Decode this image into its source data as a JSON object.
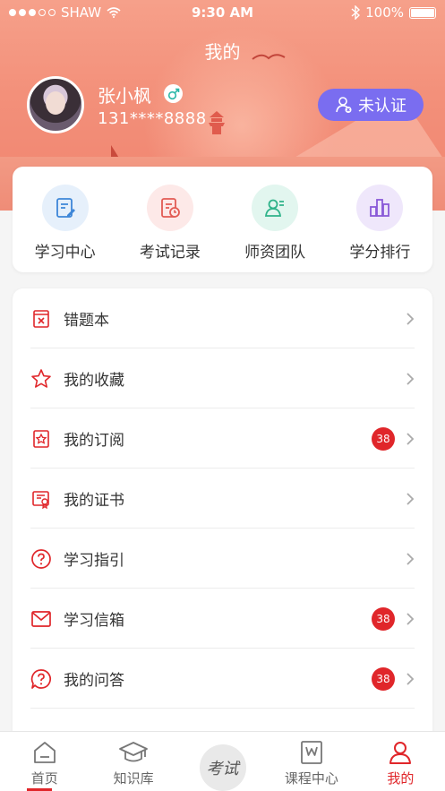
{
  "status": {
    "carrier": "SHAW",
    "time": "9:30 AM",
    "battery": "100%"
  },
  "header": {
    "title": "我的"
  },
  "profile": {
    "name": "张小枫",
    "phone": "131****8888",
    "verify_label": "未认证"
  },
  "quick_nav": [
    {
      "label": "学习中心",
      "icon": "study-center-icon",
      "bg": "#e6f0fb",
      "color": "#3d86d8"
    },
    {
      "label": "考试记录",
      "icon": "exam-record-icon",
      "bg": "#fde9e8",
      "color": "#e25b53"
    },
    {
      "label": "师资团队",
      "icon": "teacher-team-icon",
      "bg": "#e2f6ef",
      "color": "#2fb38a"
    },
    {
      "label": "学分排行",
      "icon": "credit-rank-icon",
      "bg": "#efe7fb",
      "color": "#8a5ad8"
    }
  ],
  "menu": [
    {
      "label": "错题本",
      "icon": "wrong-book-icon",
      "badge": ""
    },
    {
      "label": "我的收藏",
      "icon": "star-icon",
      "badge": ""
    },
    {
      "label": "我的订阅",
      "icon": "subscription-icon",
      "badge": "38"
    },
    {
      "label": "我的证书",
      "icon": "certificate-icon",
      "badge": ""
    },
    {
      "label": "学习指引",
      "icon": "question-circle-icon",
      "badge": ""
    },
    {
      "label": "学习信箱",
      "icon": "mail-icon",
      "badge": "38"
    },
    {
      "label": "我的问答",
      "icon": "qa-bubble-icon",
      "badge": "38"
    }
  ],
  "tabs": [
    {
      "label": "首页",
      "icon": "home-icon"
    },
    {
      "label": "知识库",
      "icon": "graduation-cap-icon"
    },
    {
      "label": "考试",
      "icon": "exam-icon"
    },
    {
      "label": "课程中心",
      "icon": "course-center-icon"
    },
    {
      "label": "我的",
      "icon": "user-icon"
    }
  ],
  "colors": {
    "accent": "#e0262a",
    "verify": "#7a6df0",
    "header": "#f3907a"
  }
}
